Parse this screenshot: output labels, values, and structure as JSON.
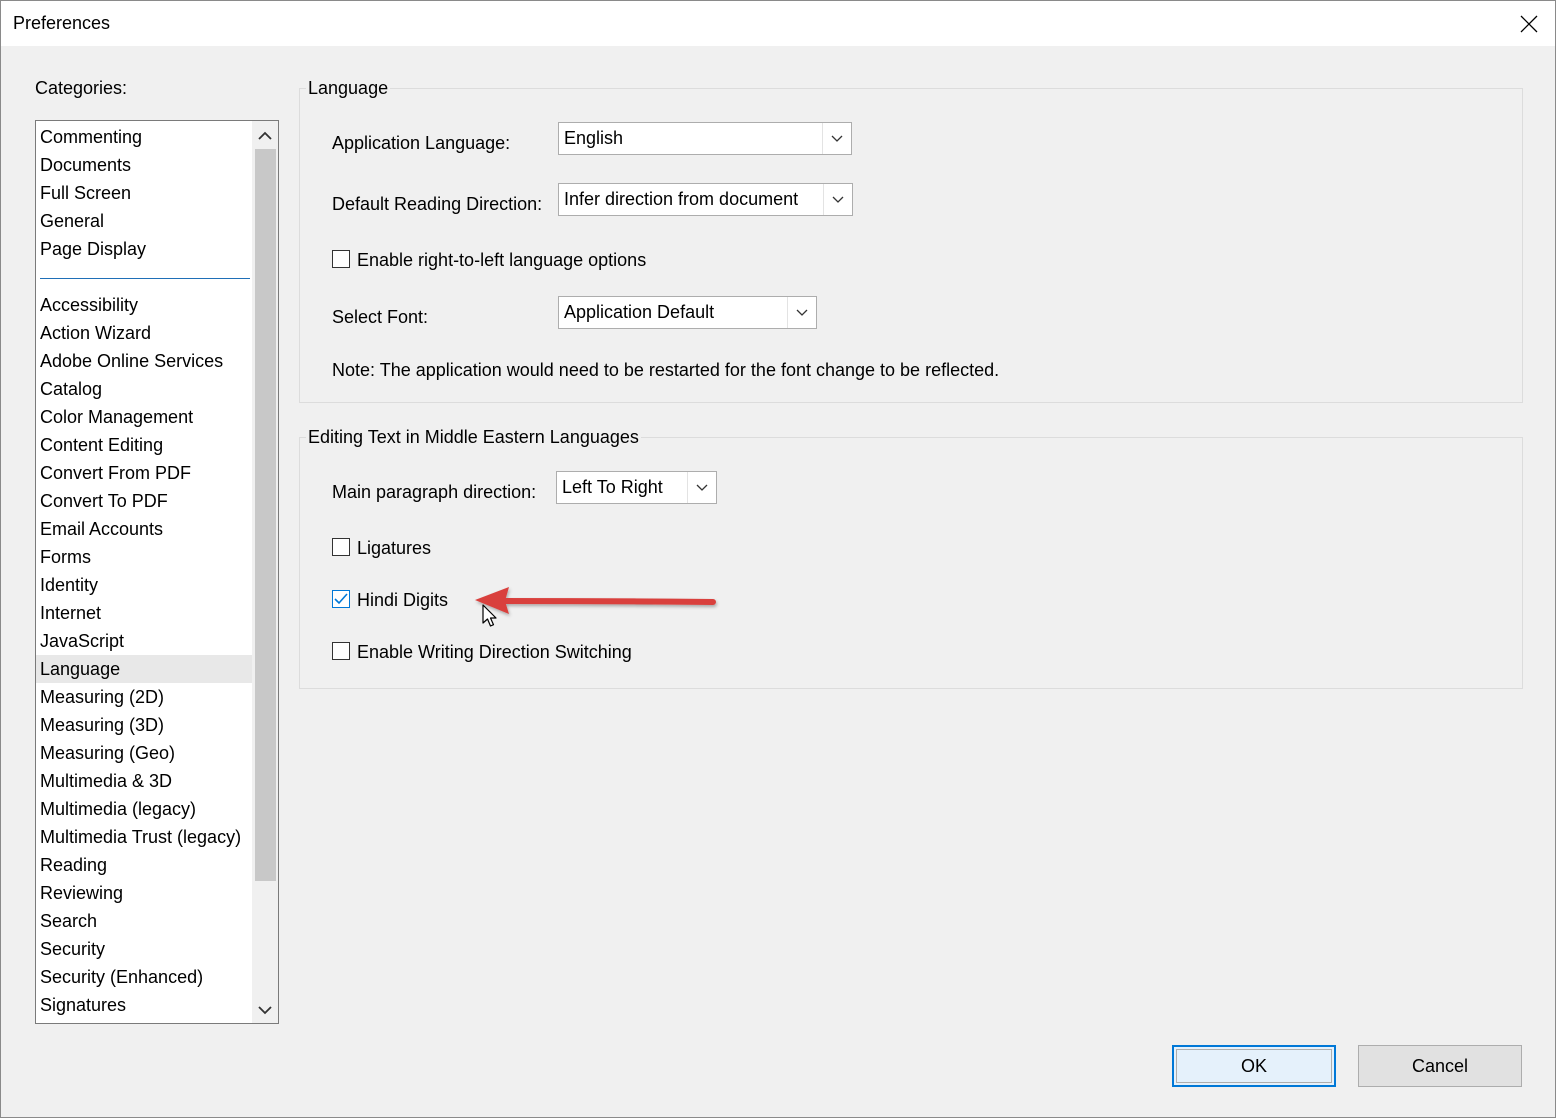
{
  "window": {
    "title": "Preferences"
  },
  "categories": {
    "label": "Categories:",
    "top_items": [
      "Commenting",
      "Documents",
      "Full Screen",
      "General",
      "Page Display"
    ],
    "items": [
      "Accessibility",
      "Action Wizard",
      "Adobe Online Services",
      "Catalog",
      "Color Management",
      "Content Editing",
      "Convert From PDF",
      "Convert To PDF",
      "Email Accounts",
      "Forms",
      "Identity",
      "Internet",
      "JavaScript",
      "Language",
      "Measuring (2D)",
      "Measuring (3D)",
      "Measuring (Geo)",
      "Multimedia & 3D",
      "Multimedia (legacy)",
      "Multimedia Trust (legacy)",
      "Reading",
      "Reviewing",
      "Search",
      "Security",
      "Security (Enhanced)",
      "Signatures"
    ],
    "selected": "Language"
  },
  "language_group": {
    "title": "Language",
    "app_language_label": "Application Language:",
    "app_language_value": "English",
    "reading_direction_label": "Default Reading Direction:",
    "reading_direction_value": "Infer direction from document",
    "rtl_label": "Enable right-to-left language options",
    "rtl_checked": false,
    "font_label": "Select Font:",
    "font_value": "Application Default",
    "note": "Note: The application would need to be restarted for the font change to be reflected."
  },
  "middle_eastern_group": {
    "title": "Editing Text in Middle Eastern Languages",
    "paragraph_direction_label": "Main paragraph direction:",
    "paragraph_direction_value": "Left To Right",
    "ligatures_label": "Ligatures",
    "ligatures_checked": false,
    "hindi_digits_label": "Hindi Digits",
    "hindi_digits_checked": true,
    "writing_direction_label": "Enable Writing Direction Switching",
    "writing_direction_checked": false
  },
  "buttons": {
    "ok": "OK",
    "cancel": "Cancel"
  },
  "colors": {
    "annotation_arrow": "#d9413e",
    "selection_accent": "#0078d7",
    "separator": "#1f6fb7"
  }
}
